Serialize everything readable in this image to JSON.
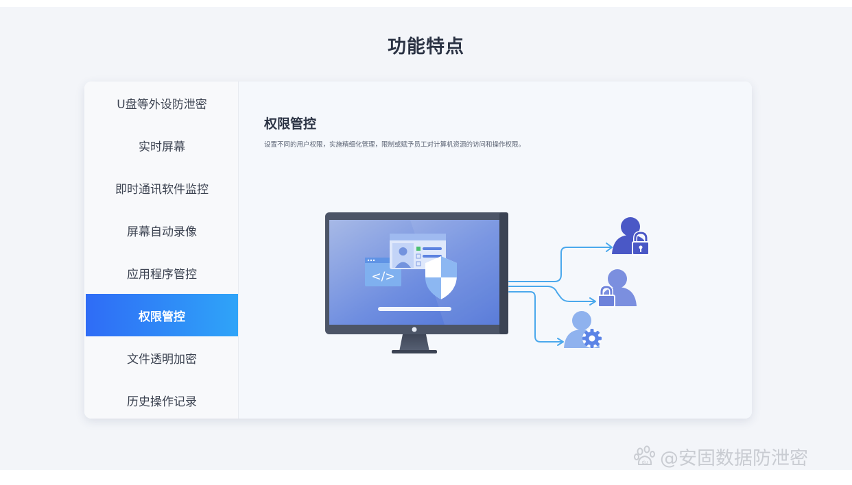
{
  "page": {
    "title": "功能特点"
  },
  "sidebar": {
    "items": [
      {
        "label": "U盘等外设防泄密",
        "active": false
      },
      {
        "label": "实时屏幕",
        "active": false
      },
      {
        "label": "即时通讯软件监控",
        "active": false
      },
      {
        "label": "屏幕自动录像",
        "active": false
      },
      {
        "label": "应用程序管控",
        "active": false
      },
      {
        "label": "权限管控",
        "active": true
      },
      {
        "label": "文件透明加密",
        "active": false
      },
      {
        "label": "历史操作记录",
        "active": false
      }
    ]
  },
  "content": {
    "title": "权限管控",
    "description": "设置不同的用户权限，实施精细化管理，限制或赋予员工对计算机资源的访问和操作权限。"
  },
  "illustration": {
    "icons": [
      "monitor-icon",
      "code-window-icon",
      "id-card-icon",
      "shield-icon",
      "user-lock-icon",
      "user-lock-icon",
      "user-gear-icon"
    ]
  },
  "colors": {
    "accent_start": "#2f6cf6",
    "accent_end": "#2fa4f8",
    "arrow": "#4aa8ec"
  },
  "watermark": {
    "text": "@安固数据防泄密",
    "logo": "du"
  }
}
